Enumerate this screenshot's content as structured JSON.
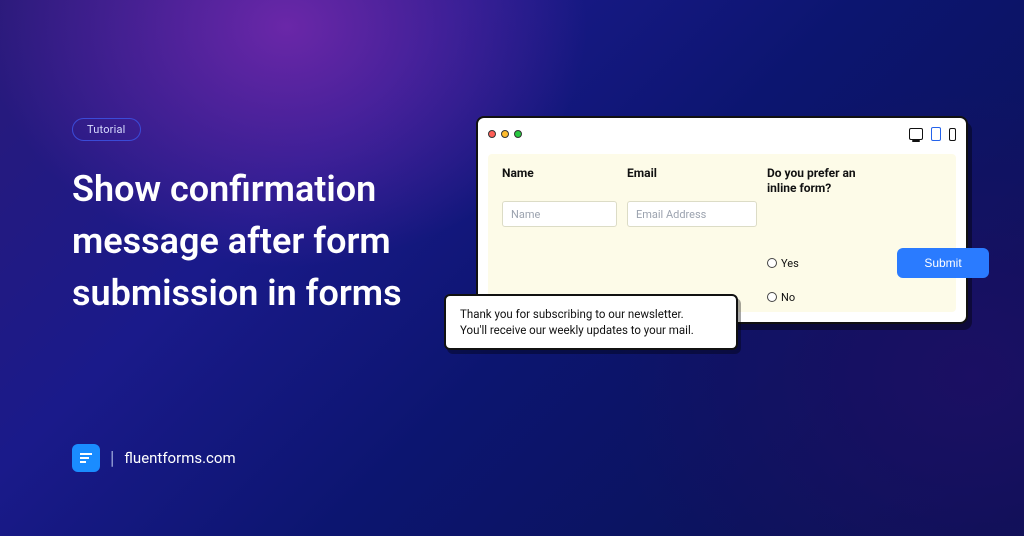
{
  "badge": "Tutorial",
  "title": "Show confirmation message after form submission in forms",
  "brand": {
    "text": "fluentforms.com",
    "separator": "|"
  },
  "window": {
    "devices": {
      "active": "tablet"
    },
    "form": {
      "name_label": "Name",
      "name_placeholder": "Name",
      "email_label": "Email",
      "email_placeholder": "Email Address",
      "pref_label": "Do you prefer an inline form?",
      "option_yes": "Yes",
      "option_no": "No",
      "submit_label": "Submit"
    }
  },
  "toast": {
    "line1": "Thank you for subscribing to our newsletter.",
    "line2": "You'll receive our weekly updates to your mail."
  }
}
